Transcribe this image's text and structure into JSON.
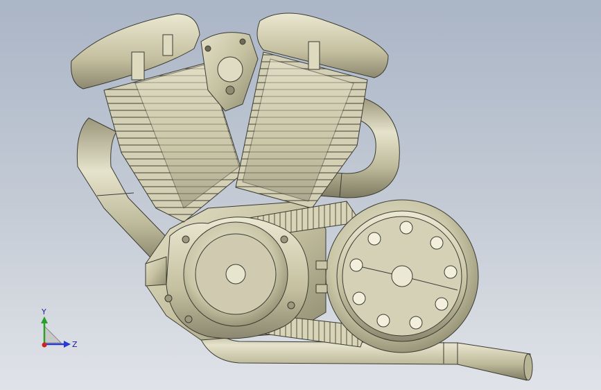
{
  "viewport": {
    "background_top": "#aab5c6",
    "background_bottom": "#e0e3e8"
  },
  "model": {
    "material_color": "#c9c5a6",
    "edge_color": "#3a3a32",
    "icon": "v-twin-engine-model"
  },
  "triad": {
    "y_label": "Y",
    "z_label": "Z",
    "y_color": "#2aa02a",
    "z_color": "#2a3ad0",
    "x_color": "#d02020"
  }
}
